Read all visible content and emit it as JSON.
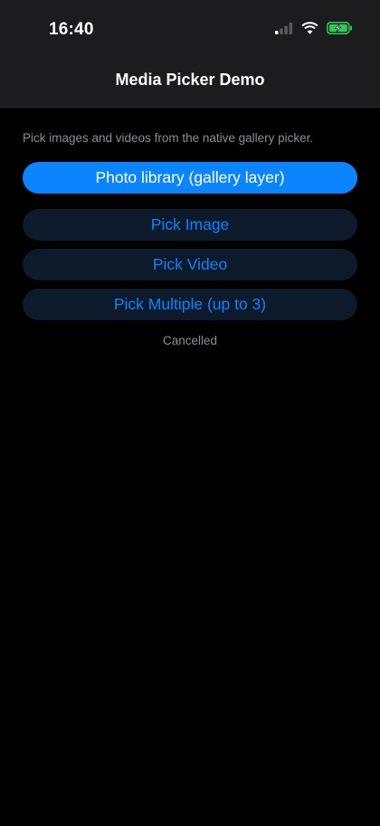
{
  "status_bar": {
    "time": "16:40",
    "icons": [
      "cellular-signal-icon",
      "wifi-icon",
      "battery-charging-icon"
    ],
    "battery_color": "#34c759"
  },
  "nav": {
    "title": "Media Picker Demo"
  },
  "main": {
    "intro": "Pick images and videos from the native gallery picker.",
    "primary_button": "Photo library (gallery layer)",
    "buttons": [
      "Pick Image",
      "Pick Video",
      "Pick Multiple (up to 3)"
    ],
    "status": "Cancelled"
  },
  "colors": {
    "accent": "#0a84ff",
    "background": "#000000",
    "header": "#1c1c1e",
    "secondary_button_bg": "#0c1a2c",
    "muted_text": "#8e8e93"
  }
}
